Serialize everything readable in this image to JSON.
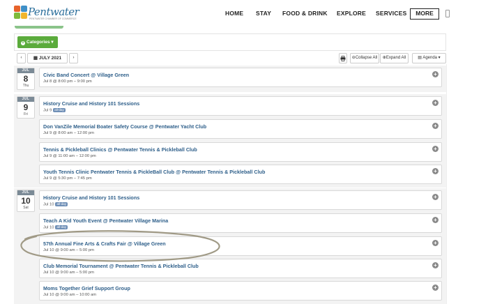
{
  "header": {
    "logo_text": "Pentwater",
    "logo_tagline": "PENTWATER CHAMBER OF COMMERCE",
    "nav": [
      "HOME",
      "STAY",
      "FOOD & DRINK",
      "EXPLORE",
      "SERVICES"
    ],
    "more_label": "MORE"
  },
  "categories": {
    "label": "Categories",
    "caret": "▾"
  },
  "toolbar": {
    "prev": "‹",
    "month": "JULY 2021",
    "next": "›",
    "print_icon": "print-icon",
    "collapse_label": "Collapse All",
    "expand_label": "Expand All",
    "view_label": "Agenda"
  },
  "days": [
    {
      "month": "JUL",
      "day": "8",
      "dow": "Thu",
      "events": [
        {
          "title": "Civic Band Concert @ Village Green",
          "time": "Jul 8 @ 8:00 pm – 9:00 pm",
          "all_day": false
        }
      ]
    },
    {
      "month": "JUL",
      "day": "9",
      "dow": "Fri",
      "events": [
        {
          "title": "History Cruise and History 101 Sessions",
          "time": "Jul 9",
          "all_day": true
        },
        {
          "title": "Don VanZile Memorial Boater Safety Course @ Pentwater Yacht Club",
          "time": "Jul 9 @ 8:00 am – 12:00 pm",
          "all_day": false
        },
        {
          "title": "Tennis & Pickleball Clinics @ Pentwater Tennis & Pickleball Club",
          "time": "Jul 9 @ 11:00 am – 12:00 pm",
          "all_day": false
        },
        {
          "title": "Youth Tennis Clinic Pentwater Tennis & PickleBall Club @ Pentwater Tennis & Pickleball Club",
          "time": "Jul 9 @ 5:30 pm – 7:45 pm",
          "all_day": false
        }
      ]
    },
    {
      "month": "JUL",
      "day": "10",
      "dow": "Sat",
      "events": [
        {
          "title": "History Cruise and History 101 Sessions",
          "time": "Jul 10",
          "all_day": true
        },
        {
          "title": "Teach A Kid Youth Event @ Pentwater Village Marina",
          "time": "Jul 10",
          "all_day": true
        },
        {
          "title": "57th Annual Fine Arts & Crafts Fair @ Village Green",
          "time": "Jul 10 @ 9:00 am – 5:00 pm",
          "all_day": false
        },
        {
          "title": "Club Memorial Tournament @ Pentwater Tennis & Pickleball Club",
          "time": "Jul 10 @ 9:00 am – 5:00 pm",
          "all_day": false
        },
        {
          "title": "Moms Together Grief Support Group",
          "time": "Jul 10 @ 9:00 am – 10:00 am",
          "all_day": false
        }
      ]
    }
  ],
  "all_day_label": "all-day",
  "expand_glyph": "+",
  "colors": {
    "accent_green": "#5bab3c",
    "event_title": "#2e5f8a",
    "annotation": "#a09a86"
  }
}
